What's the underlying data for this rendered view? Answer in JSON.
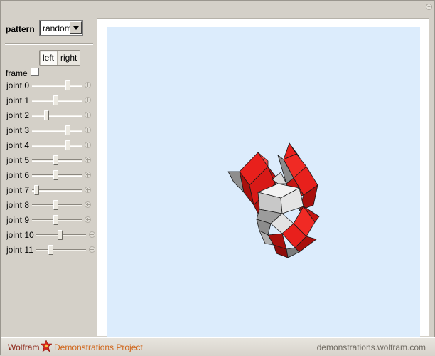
{
  "controls": {
    "pattern_label": "pattern",
    "pattern_value": "random",
    "side_options": [
      "left",
      "right"
    ],
    "side_selected": "left",
    "frame_label": "frame",
    "frame_checked": false,
    "joints": [
      {
        "label": "joint 0",
        "value": 0.74
      },
      {
        "label": "joint 1",
        "value": 0.48
      },
      {
        "label": "joint 2",
        "value": 0.27
      },
      {
        "label": "joint 3",
        "value": 0.74
      },
      {
        "label": "joint 4",
        "value": 0.74
      },
      {
        "label": "joint 5",
        "value": 0.48
      },
      {
        "label": "joint 6",
        "value": 0.48
      },
      {
        "label": "joint 7",
        "value": 0.05
      },
      {
        "label": "joint 8",
        "value": 0.48
      },
      {
        "label": "joint 9",
        "value": 0.48
      },
      {
        "label": "joint 10",
        "value": 0.48
      },
      {
        "label": "joint 11",
        "value": 0.27
      }
    ]
  },
  "footer": {
    "brand_wolfram": "Wolfram",
    "brand_demos": "Demonstrations Project",
    "url": "demonstrations.wolfram.com"
  },
  "colors": {
    "plot_background": "#dcecfc",
    "face_red": "#e8201c",
    "face_dark_red": "#a80f0c",
    "face_gray": "#9a9a9a",
    "face_light": "#e6e6e6"
  }
}
